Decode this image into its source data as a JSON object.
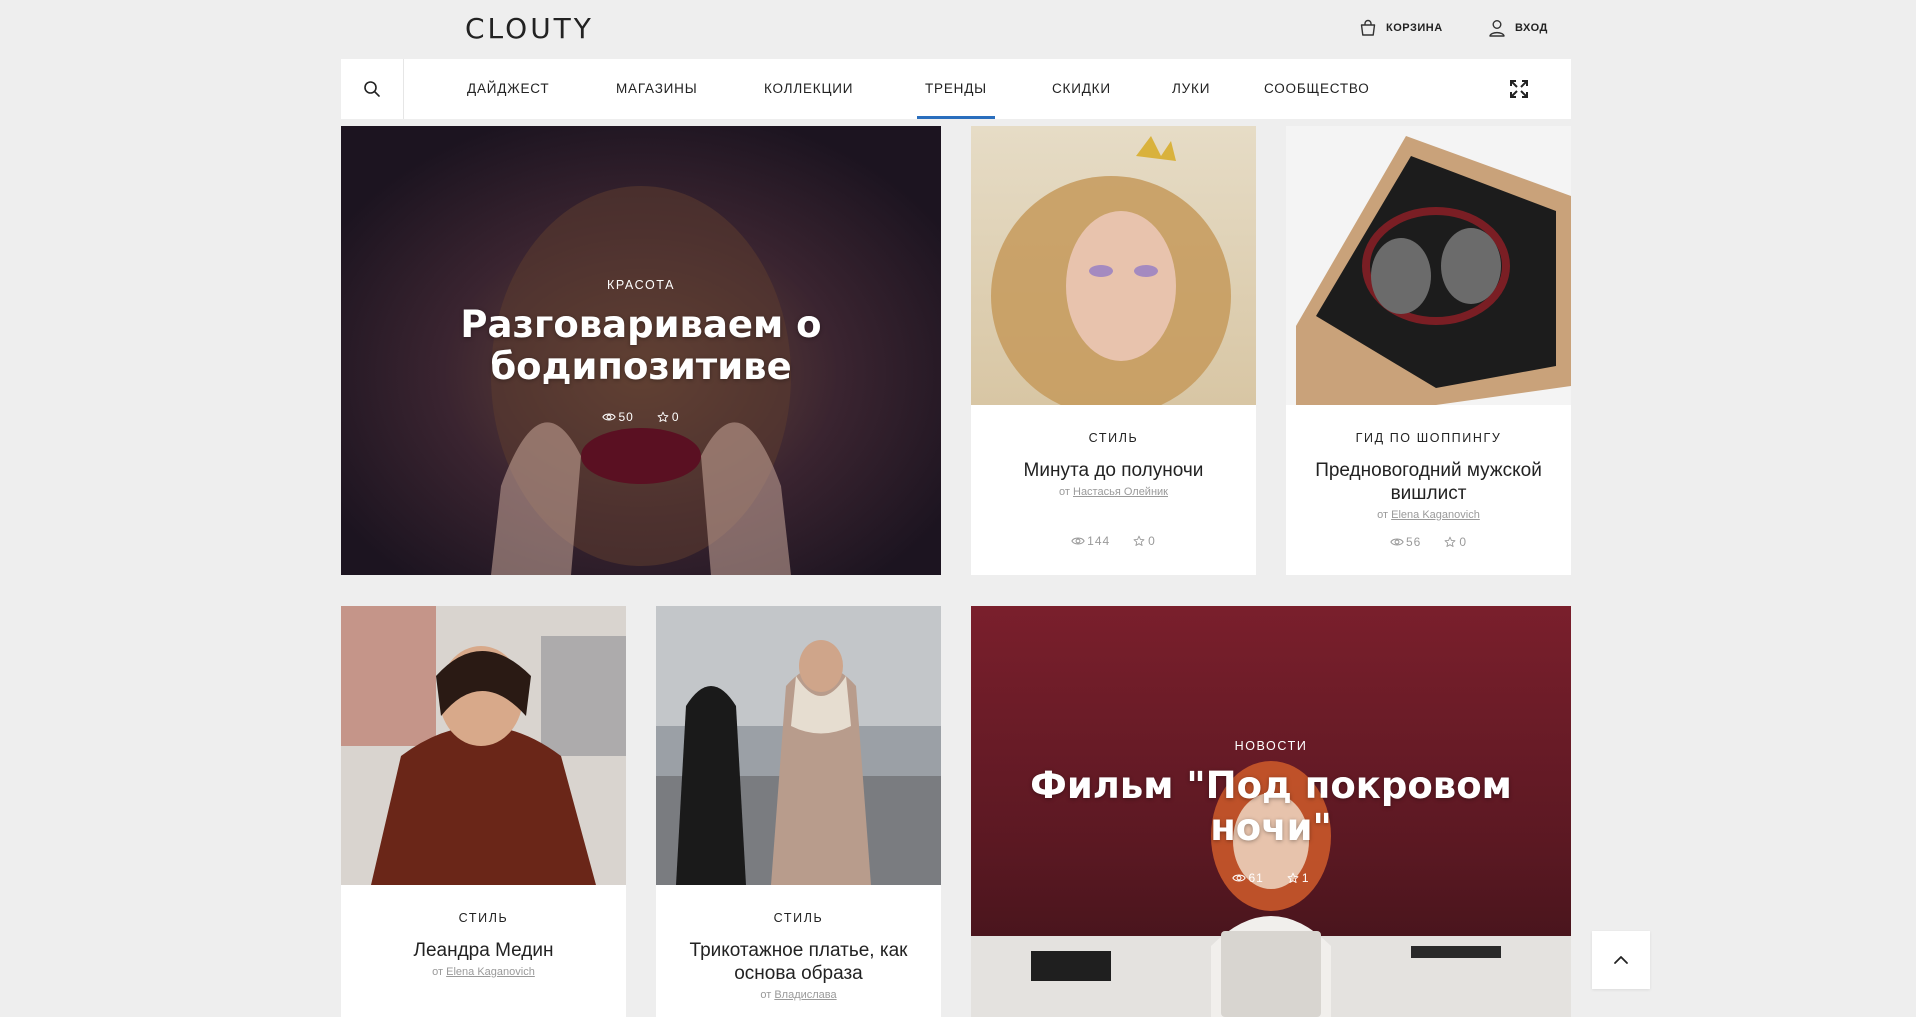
{
  "header": {
    "logo": "CLOUTY",
    "cart_label": "КОРЗИНА",
    "login_label": "ВХОД"
  },
  "nav": {
    "items": [
      {
        "label": "ДАЙДЖЕСТ",
        "active": false
      },
      {
        "label": "МАГАЗИНЫ",
        "active": false
      },
      {
        "label": "КОЛЛЕКЦИИ",
        "active": false
      },
      {
        "label": "ТРЕНДЫ",
        "active": true
      },
      {
        "label": "СКИДКИ",
        "active": false
      },
      {
        "label": "ЛУКИ",
        "active": false
      },
      {
        "label": "СООБЩЕСТВО",
        "active": false
      }
    ],
    "accent_color": "#2a6ebd"
  },
  "articles": {
    "a1": {
      "category": "КРАСОТА",
      "title": "Разговариваем о бодипозитиве",
      "views": "50",
      "favorites": "0"
    },
    "a2": {
      "category": "СТИЛЬ",
      "title": "Минута до полуночи",
      "author_prefix": "от",
      "author": "Настасья Олейник",
      "views": "144",
      "favorites": "0"
    },
    "a3": {
      "category": "ГИД ПО ШОППИНГУ",
      "title": "Предновогодний мужской вишлист",
      "author_prefix": "от",
      "author": "Elena Kaganovich",
      "views": "56",
      "favorites": "0"
    },
    "a4": {
      "category": "СТИЛЬ",
      "title": "Леандра Медин",
      "author_prefix": "от",
      "author": "Elena Kaganovich"
    },
    "a5": {
      "category": "СТИЛЬ",
      "title": "Трикотажное платье, как основа образа",
      "author_prefix": "от",
      "author": "Владислава"
    },
    "a6": {
      "category": "НОВОСТИ",
      "title": "Фильм \"Под покровом ночи\"",
      "views": "61",
      "favorites": "1"
    }
  },
  "icons": {
    "search": "search-icon",
    "cart": "shopping-bag-icon",
    "user": "user-icon",
    "expand": "fullscreen-icon",
    "views": "eye-icon",
    "favorites": "star-icon",
    "scroll_top": "chevron-up-icon"
  }
}
